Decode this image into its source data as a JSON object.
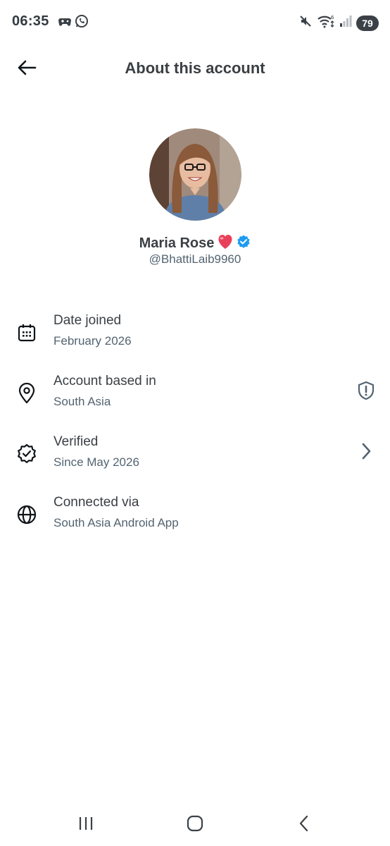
{
  "status_bar": {
    "time": "06:35",
    "battery": "79",
    "left_icons": [
      "game-controller-icon",
      "whatsapp-icon"
    ],
    "right_icons": [
      "mute-icon",
      "wifi-icon",
      "signal-icon"
    ]
  },
  "header": {
    "title": "About this account"
  },
  "profile": {
    "name": "Maria Rose",
    "name_emoji": "❤️",
    "handle": "@BhattiLaib9960",
    "verified_color": "#1d9bf0"
  },
  "info": [
    {
      "label": "Date joined",
      "value": "February 2026",
      "icon": "calendar-icon"
    },
    {
      "label": "Account based in",
      "value": "South Asia",
      "icon": "location-pin-icon",
      "trailing": "shield-alert-icon"
    },
    {
      "label": "Verified",
      "value": "Since May 2026",
      "icon": "verified-badge-icon",
      "trailing": "chevron-right-icon"
    },
    {
      "label": "Connected via",
      "value": "South Asia Android App",
      "icon": "globe-icon"
    }
  ],
  "nav": [
    "recent-apps-icon",
    "home-icon",
    "back-nav-icon"
  ]
}
